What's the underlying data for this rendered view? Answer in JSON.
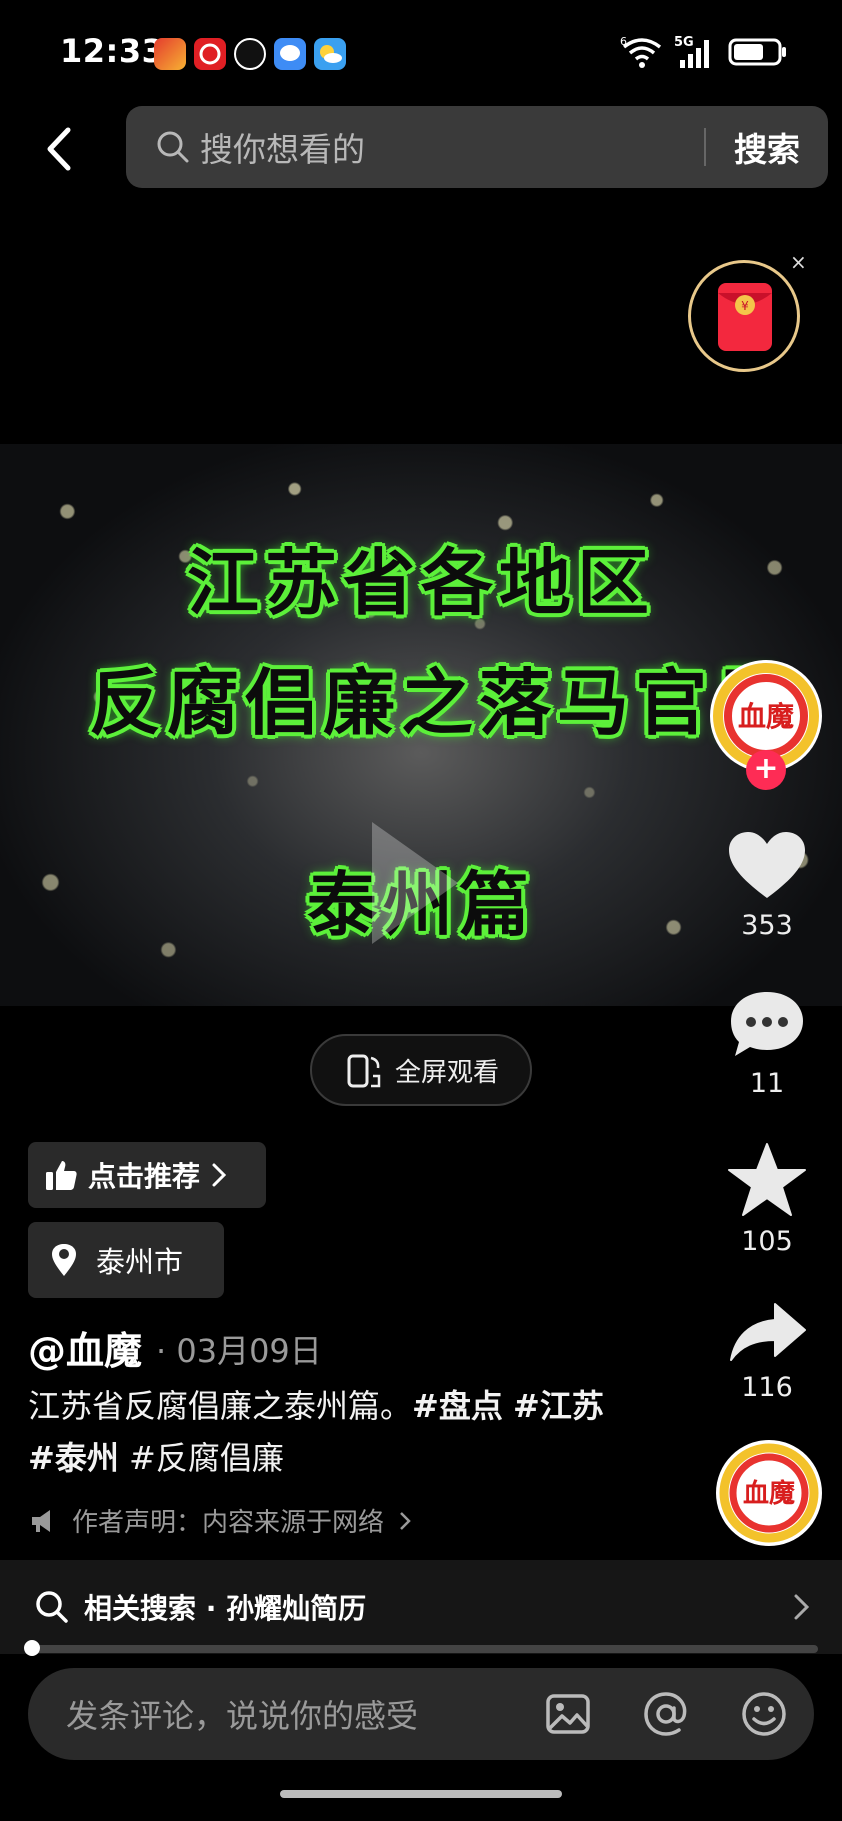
{
  "status_bar": {
    "time": "12:33",
    "network": "5G",
    "wifi_badge": "6",
    "battery_fraction": 0.7,
    "app_icons": [
      "app-red-icon",
      "app-netease-icon",
      "app-hand-icon",
      "app-message-icon",
      "app-weather-icon"
    ]
  },
  "header": {
    "search_placeholder": "搜你想看的",
    "search_button": "搜索"
  },
  "red_packet": {
    "close": "×",
    "coin": "¥"
  },
  "video": {
    "title_line1": "江苏省各地区",
    "title_line2": "反腐倡廉之落马官员",
    "title_line3": "泰州篇",
    "fullscreen_label": "全屏观看"
  },
  "actions": {
    "avatar_text": "血魔",
    "follow_plus": "+",
    "likes": "353",
    "comments": "11",
    "favorites": "105",
    "shares": "116"
  },
  "info": {
    "recommend_label": "点击推荐",
    "location_label": "泰州市",
    "author": "@血魔",
    "date": "· 03月09日",
    "desc_text": "江苏省反腐倡廉之泰州篇。",
    "tag1": "#盘点",
    "tag2": "#江苏",
    "tag3": "#泰州",
    "tag4": "#反腐倡廉",
    "declaration": "作者声明：内容来源于网络"
  },
  "related": {
    "label": "相关搜索 · 孙耀灿简历"
  },
  "progress": {
    "fraction": 0.005
  },
  "comment": {
    "placeholder": "发条评论，说说你的感受"
  },
  "colors": {
    "accent_red": "#fe2c55",
    "title_green": "#5cf03a",
    "background": "#000000"
  }
}
